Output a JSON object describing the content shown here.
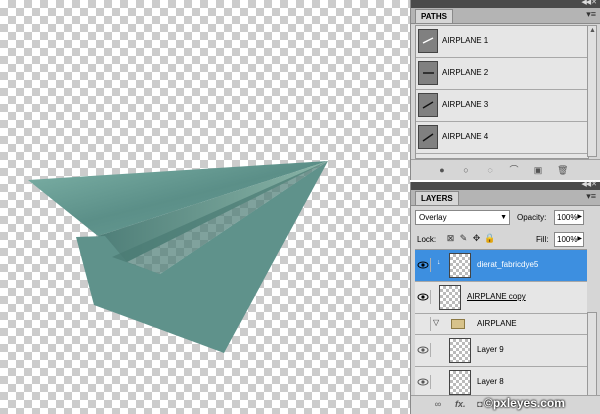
{
  "paths_panel": {
    "tab": "PATHS",
    "items": [
      {
        "label": "AIRPLANE 1"
      },
      {
        "label": "AIRPLANE 2"
      },
      {
        "label": "AIRPLANE 3"
      },
      {
        "label": "AIRPLANE 4"
      }
    ]
  },
  "layers_panel": {
    "tab": "LAYERS",
    "blend_mode": "Overlay",
    "opacity_label": "Opacity:",
    "opacity_value": "100%",
    "lock_label": "Lock:",
    "fill_label": "Fill:",
    "fill_value": "100%",
    "layers": [
      {
        "name": "dierat_fabricdye5"
      },
      {
        "name": "AIRPLANE copy"
      },
      {
        "name": "AIRPLANE"
      },
      {
        "name": "Layer 9"
      },
      {
        "name": "Layer 8"
      }
    ],
    "fx_label": "fx."
  },
  "watermark": "©pxleyes.com",
  "colors": {
    "selection": "#3d8fe0",
    "plane_light": "#6a9c94",
    "plane_dark": "#3f6f6a"
  }
}
